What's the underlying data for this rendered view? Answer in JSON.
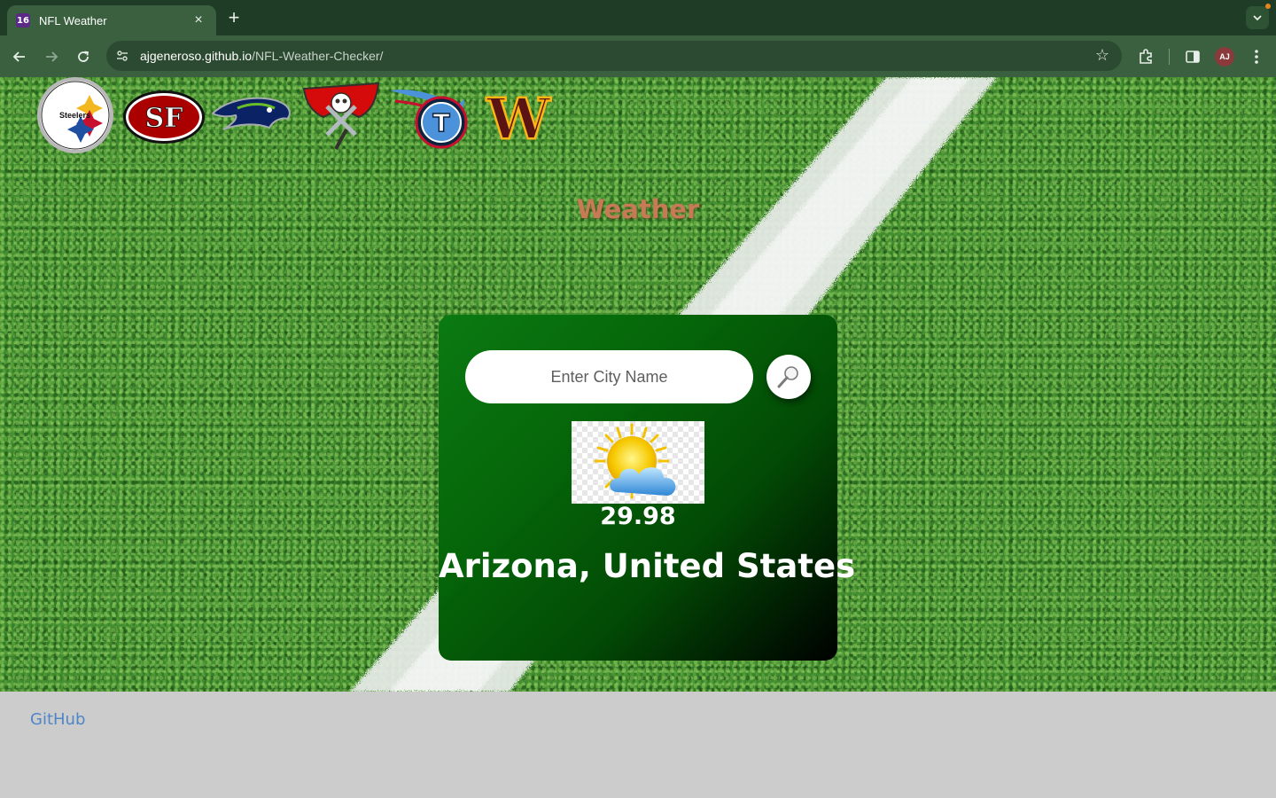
{
  "browser": {
    "tab": {
      "title": "NFL Weather",
      "favicon_text": "16",
      "close_icon": "×"
    },
    "new_tab_icon": "+",
    "url_host": "ajgeneroso.github.io",
    "url_path": "/NFL-Weather-Checker/",
    "profile_initials": "AJ"
  },
  "header": {
    "logos": [
      {
        "team": "Steelers",
        "wordmark": "Steelers"
      },
      {
        "team": "49ers",
        "wordmark": "SF"
      },
      {
        "team": "Seahawks"
      },
      {
        "team": "Buccaneers"
      },
      {
        "team": "Titans",
        "wordmark": "T"
      },
      {
        "team": "Commanders",
        "wordmark": "W"
      }
    ]
  },
  "main": {
    "title": "Weather",
    "search": {
      "placeholder": "Enter City Name",
      "value": ""
    },
    "weather_icon": "partly-cloudy-icon",
    "temperature": "29.98",
    "location": "Arizona, United States"
  },
  "footer": {
    "link_label": "GitHub"
  },
  "colors": {
    "title": "#c67a55",
    "card_start": "#0b7a12",
    "card_end": "#000000",
    "link": "#4f86c6",
    "footer_bg": "#cccccc",
    "chrome_dark": "#1f3d26",
    "chrome_light": "#3b6040"
  }
}
